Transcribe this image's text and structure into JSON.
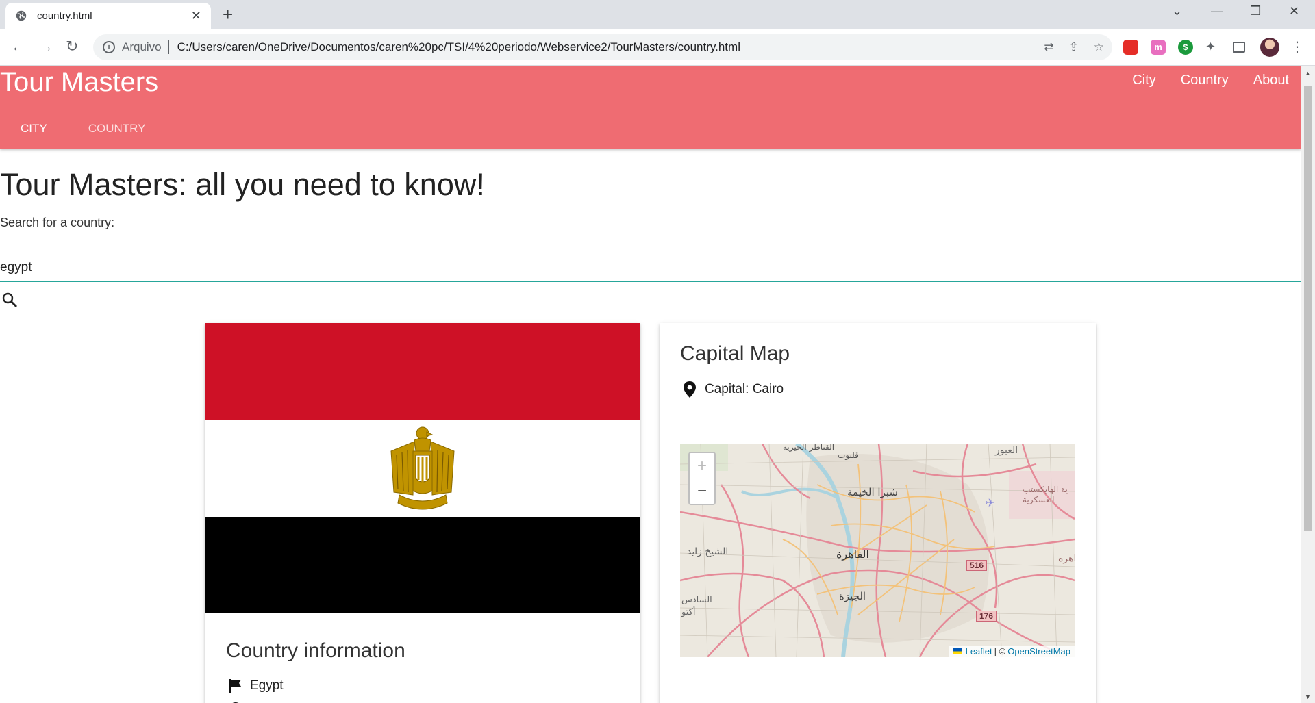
{
  "browser": {
    "tab_title": "country.html",
    "tab_close": "✕",
    "new_tab": "+",
    "address_prefix": "Arquivo",
    "url": "C:/Users/caren/OneDrive/Documentos/caren%20pc/TSI/4%20periodo/Webservice2/TourMasters/country.html",
    "extension_m": "m",
    "extension_s": "$"
  },
  "navbar": {
    "brand": "Tour Masters",
    "links": [
      "City",
      "Country",
      "About"
    ],
    "tabs": [
      "CITY",
      "COUNTRY"
    ]
  },
  "main": {
    "heading": "Tour Masters: all you need to know!",
    "search_label": "Search for a country:",
    "search_value": "egypt"
  },
  "flag_card": {
    "title": "Country information",
    "country_name": "Egypt",
    "colors": {
      "red": "#ce1126",
      "white": "#ffffff",
      "black": "#000000",
      "gold": "#c09300"
    }
  },
  "map_card": {
    "title": "Capital Map",
    "capital": "Capital: Cairo",
    "zoom_in": "+",
    "zoom_out": "−",
    "attribution_leaflet": "Leaflet",
    "attribution_sep": "| ©",
    "attribution_osm": "OpenStreetMap",
    "labels": {
      "cairo": "القاهرة",
      "giza": "الجيزة",
      "shubra": "شبرا الخيمة",
      "sheikh_zayed": "الشيخ زايد",
      "obour": "العبور",
      "qaliub": "قليوب",
      "qanater": "القناطر الخيرية",
      "october": "السادس أكتو",
      "hikestep": "ية الهايكستب العسكرية",
      "cairo_new": "اهرة",
      "road_516": "516",
      "road_176": "176"
    }
  },
  "theme": {
    "navbar": "#ef6c72",
    "input_underline": "#26a69a"
  }
}
